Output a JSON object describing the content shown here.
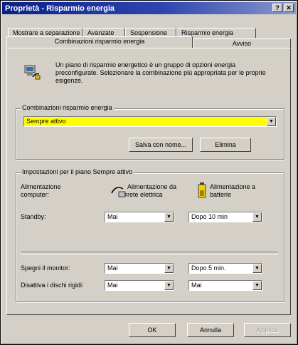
{
  "window": {
    "title": "Proprietà - Risparmio energia",
    "help_label": "?",
    "close_label": "✕"
  },
  "tabs_back": [
    {
      "label": "Mostrare a separazione"
    },
    {
      "label": "Avanzate"
    },
    {
      "label": "Sospensione"
    },
    {
      "label": "Risparmio energia"
    }
  ],
  "tabs_front": [
    {
      "label": "Combinazioni risparmio energia"
    },
    {
      "label": "Avviso"
    }
  ],
  "intro": {
    "text": "Un piano di risparmio energetico è un gruppo di opzioni energia preconfigurate. Selezionare la combinazione più appropriata per le proprie esigenze."
  },
  "scheme_group": {
    "label": "Combinazioni risparmio energia",
    "selected": "Sempre attivo",
    "save_as_label": "Salva con nome...",
    "delete_label": "Elimina"
  },
  "settings_group": {
    "label": "Impostazioni per il piano Sempre attivo",
    "when_computer": "Alimentazione computer:",
    "plugged_in": "Alimentazione da rete elettrica",
    "on_batteries": "Alimentazione a batterie",
    "rows": [
      {
        "label": "Standby:",
        "ac_value": "Mai",
        "dc_value": "Dopo 10 min"
      },
      {
        "label": "Spegni il monitor:",
        "ac_value": "Mai",
        "dc_value": "Dopo 5 min."
      },
      {
        "label": "Disattiva i dischi rigidi:",
        "ac_value": "Mai",
        "dc_value": "Mai"
      }
    ]
  },
  "footer": {
    "ok_label": "OK",
    "cancel_label": "Annulla",
    "apply_label": "Applica"
  },
  "colors": {
    "title_start": "#0a1f8a",
    "title_end": "#8a98cc",
    "selection": "#ffff00"
  }
}
